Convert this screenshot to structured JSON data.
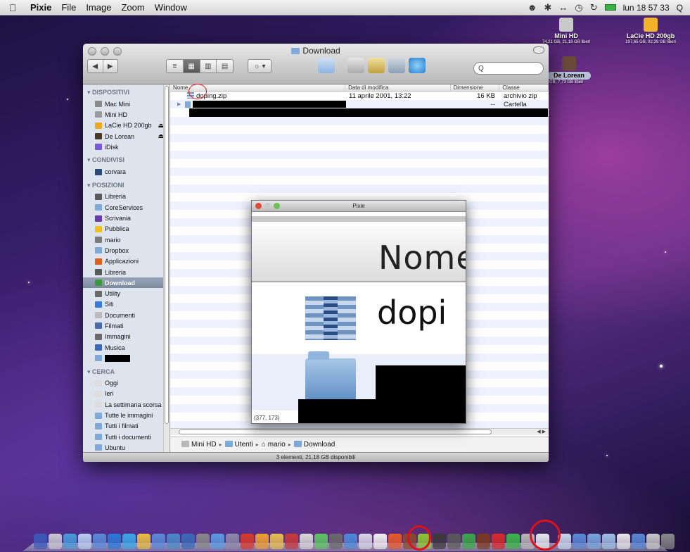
{
  "menubar": {
    "apple": "",
    "items": [
      "Pixie",
      "File",
      "Image",
      "Zoom",
      "Window"
    ],
    "clock": "lun 18 57 33",
    "search_glyph": "Q"
  },
  "desktop": {
    "icons": [
      {
        "name": "Mini HD",
        "info": "74,21 GB, 21,18 GB liberi",
        "color": "#c9c9c9"
      },
      {
        "name": "LaCie HD 200gb",
        "info": "197,65 GB, 92,39 GB liberi",
        "color": "#f2b32a"
      },
      {
        "name": "De Lorean",
        "info": "i GB, 7,73 GB liberi",
        "color": "#6b4a3a"
      }
    ]
  },
  "finder": {
    "title": "Download",
    "search_placeholder": "Q",
    "view_modes": [
      "≡",
      "▦",
      "▥",
      "▤"
    ],
    "action_label": "☼ ▾",
    "sidebar": {
      "sections": [
        {
          "label": "DISPOSITIVI",
          "items": [
            {
              "label": "Mac Mini",
              "icon": "computer-icon",
              "color": "#8a8a8a"
            },
            {
              "label": "Mini HD",
              "icon": "drive-icon",
              "color": "#9a9a9a"
            },
            {
              "label": "LaCie HD 200gb",
              "icon": "drive-icon",
              "color": "#f0a820",
              "eject": "⏏"
            },
            {
              "label": "De Lorean",
              "icon": "drive-icon",
              "color": "#4a3a2a",
              "eject": "⏏"
            },
            {
              "label": "iDisk",
              "icon": "idisk-icon",
              "color": "#7a5ad8"
            }
          ]
        },
        {
          "label": "CONDIVISI",
          "items": [
            {
              "label": "corvara",
              "icon": "monitor-icon",
              "color": "#2a4a7a"
            }
          ]
        },
        {
          "label": "POSIZIONI",
          "items": [
            {
              "label": "Libreria",
              "icon": "library-icon",
              "color": "#5a5a5a"
            },
            {
              "label": "CoreServices",
              "icon": "folder-icon",
              "color": "#7fa9d6"
            },
            {
              "label": "Scrivania",
              "icon": "desktop-icon",
              "color": "#6a3aa8"
            },
            {
              "label": "Pubblica",
              "icon": "public-icon",
              "color": "#f0c020"
            },
            {
              "label": "mario",
              "icon": "home-icon",
              "color": "#7a7a7a"
            },
            {
              "label": "Dropbox",
              "icon": "folder-icon",
              "color": "#7fa9d6"
            },
            {
              "label": "Applicazioni",
              "icon": "apps-icon",
              "color": "#e06020"
            },
            {
              "label": "Libreria",
              "icon": "library-icon",
              "color": "#5a5a5a"
            },
            {
              "label": "Download",
              "icon": "download-icon",
              "color": "#3a9a3a",
              "selected": true
            },
            {
              "label": "Utility",
              "icon": "utility-icon",
              "color": "#6a6a6a"
            },
            {
              "label": "Siti",
              "icon": "sites-icon",
              "color": "#3a7ad8"
            },
            {
              "label": "Documenti",
              "icon": "documents-icon",
              "color": "#bbbbbb"
            },
            {
              "label": "Filmati",
              "icon": "movies-icon",
              "color": "#4a6aa8"
            },
            {
              "label": "Immagini",
              "icon": "pictures-icon",
              "color": "#6a6a6a"
            },
            {
              "label": "Musica",
              "icon": "music-icon",
              "color": "#3a6ab8"
            },
            {
              "label": "",
              "icon": "folder-icon",
              "color": "#7fa9d6",
              "redacted": true
            }
          ]
        },
        {
          "label": "CERCA",
          "items": [
            {
              "label": "Oggi",
              "icon": "clock-icon",
              "color": "#dddddd"
            },
            {
              "label": "Ieri",
              "icon": "clock-icon",
              "color": "#dddddd"
            },
            {
              "label": "La settimana scorsa",
              "icon": "clock-icon",
              "color": "#dddddd"
            },
            {
              "label": "Tutte le immagini",
              "icon": "folder-icon",
              "color": "#7fa9d6"
            },
            {
              "label": "Tutti i filmati",
              "icon": "folder-icon",
              "color": "#7fa9d6"
            },
            {
              "label": "Tutti i documenti",
              "icon": "folder-icon",
              "color": "#7fa9d6"
            },
            {
              "label": "Ubuntu",
              "icon": "folder-icon",
              "color": "#7fa9d6"
            }
          ]
        }
      ]
    },
    "columns": [
      "Nome",
      "Data di modifica",
      "Dimensione",
      "Classe"
    ],
    "files": [
      {
        "name": "doping.zip",
        "date": "11 aprile 2001, 13:22",
        "size": "16 KB",
        "kind": "archivio zip",
        "icon": "zip-icon"
      },
      {
        "name": "",
        "date": "",
        "size": "--",
        "kind": "Cartella",
        "icon": "folder-icon",
        "redacted": true
      },
      {
        "name": "",
        "date": "",
        "size": "",
        "kind": "",
        "redacted_full": true
      }
    ],
    "path": [
      "Mini HD",
      "Utenti",
      "mario",
      "Download"
    ],
    "status": "3 elementi, 21,18 GB disponibili"
  },
  "pixie": {
    "title": "Pixie",
    "zoom_head_text": "Nome",
    "zoom_file_text": "dopi",
    "coords": "(377, 173)"
  },
  "dock": {
    "colors": [
      "#3a5ab8",
      "#c8c8d0",
      "#4a9ad8",
      "#b8d0f0",
      "#5a8ad8",
      "#2a7ad8",
      "#3aa8e8",
      "#e8c040",
      "#5a8ad8",
      "#4a8ac8",
      "#3a6ab8",
      "#888888",
      "#5a9ae0",
      "#8a8aa8",
      "#d83a2a",
      "#f0a030",
      "#e8c050",
      "#c83a3a",
      "#d8d8d8",
      "#5ac860",
      "#6a6a6a",
      "#4a8ad8",
      "#d8d8e8",
      "#f0f0f0",
      "#e85a2a",
      "#8a4a2a",
      "#8ac830",
      "#3a3a3a",
      "#5a5a5a",
      "#3aa848",
      "#7a3a20",
      "#d82a2a",
      "#3ab848",
      "#b8b8b8",
      "#e8e8f0",
      "#c8d8f0",
      "#5a8ad8",
      "#7aa8e0",
      "#a0c0e8",
      "#e8e8e8",
      "#5a8ad8",
      "#c8c8c8",
      "#8a8a8a"
    ]
  },
  "annotations": {
    "ring_color": "#e0101a"
  }
}
